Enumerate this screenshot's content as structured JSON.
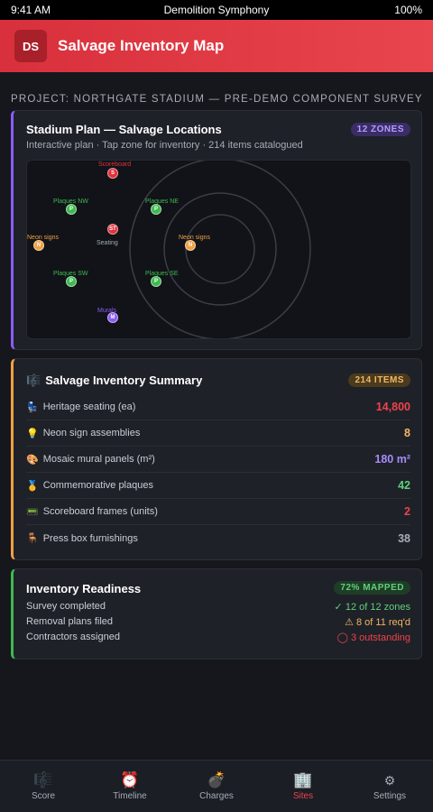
{
  "status": {
    "time": "9:41 AM",
    "title": "Demolition Symphony",
    "battery": "100%"
  },
  "app": {
    "logo": "DS",
    "title": "Salvage Inventory Map"
  },
  "project": "PROJECT: NORTHGATE STADIUM — PRE-DEMO COMPONENT SURVEY",
  "map_card": {
    "title": "Stadium Plan — Salvage Locations",
    "badge": "12 ZONES",
    "subtitle": "Interactive plan · Tap zone for inventory · 214 items catalogued",
    "zones": [
      {
        "letter": "S",
        "label": "Scoreboard",
        "color": "#e0323c"
      },
      {
        "letter": "P",
        "label": "Plaques NW",
        "color": "#3fb950"
      },
      {
        "letter": "P",
        "label": "Plaques NE",
        "color": "#3fb950"
      },
      {
        "letter": "ST",
        "label": "Seating",
        "color": "#e0323c"
      },
      {
        "letter": "N",
        "label": "Neon signs",
        "color": "#f0a044"
      },
      {
        "letter": "N",
        "label": "Neon signs",
        "color": "#f0a044"
      },
      {
        "letter": "P",
        "label": "Plaques SW",
        "color": "#3fb950"
      },
      {
        "letter": "P",
        "label": "Plaques SE",
        "color": "#3fb950"
      },
      {
        "letter": "M",
        "label": "Murals",
        "color": "#8b5cf6"
      }
    ]
  },
  "summary_card": {
    "icon": "🎼",
    "title": "Salvage Inventory Summary",
    "badge": "214 ITEMS",
    "rows": [
      {
        "icon": "💺",
        "label": "Heritage seating (ea)",
        "value": "14,800",
        "color": "#f0424c"
      },
      {
        "icon": "💡",
        "label": "Neon sign assemblies",
        "value": "8",
        "color": "#f4b662"
      },
      {
        "icon": "🎨",
        "label": "Mosaic mural panels (m²)",
        "value": "180 m²",
        "color": "#a78bfa"
      },
      {
        "icon": "🥇",
        "label": "Commemorative plaques",
        "value": "42",
        "color": "#5fd07a"
      },
      {
        "icon": "📟",
        "label": "Scoreboard frames (units)",
        "value": "2",
        "color": "#f0424c"
      },
      {
        "icon": "🪑",
        "label": "Press box furnishings",
        "value": "38",
        "color": "#a6acb6"
      }
    ]
  },
  "readiness_card": {
    "title": "Inventory Readiness",
    "badge": "72% MAPPED",
    "rows": [
      {
        "label": "Survey completed",
        "value": "✓ 12 of 12 zones",
        "color": "#5fd07a"
      },
      {
        "label": "Removal plans filed",
        "value": "⚠ 8 of 11 req'd",
        "color": "#f4b662"
      },
      {
        "label": "Contractors assigned",
        "value": "◯ 3 outstanding",
        "color": "#f0424c"
      }
    ]
  },
  "tabs": [
    {
      "icon": "🎼",
      "label": "Score"
    },
    {
      "icon": "⏰",
      "label": "Timeline"
    },
    {
      "icon": "💣",
      "label": "Charges"
    },
    {
      "icon": "🏢",
      "label": "Sites"
    },
    {
      "icon": "⚙",
      "label": "Settings"
    }
  ],
  "colors": {
    "accent": "#e8454e",
    "purple": "#8b5cf6",
    "orange": "#f0a044",
    "green": "#3fb950"
  }
}
